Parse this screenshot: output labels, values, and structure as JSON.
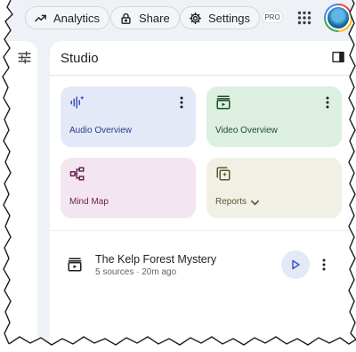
{
  "topbar": {
    "analytics_label": "Analytics",
    "share_label": "Share",
    "settings_label": "Settings",
    "pro_badge": "PRO"
  },
  "studio": {
    "title": "Studio",
    "cards": {
      "audio_overview": "Audio Overview",
      "video_overview": "Video Overview",
      "mind_map": "Mind Map",
      "reports": "Reports"
    },
    "notes": [
      {
        "title": "The Kelp Forest Mystery",
        "meta": "5 sources · 20m ago"
      }
    ]
  },
  "colors": {
    "audio_card": "#e4e9f7",
    "video_card": "#dcefe0",
    "mind_card": "#f3e6f0",
    "reports_card": "#f1f0e4",
    "accent_blue": "#3c4fc4"
  },
  "icons": {
    "analytics": "trending-up-icon",
    "share": "lock-icon",
    "settings": "gear-icon",
    "apps": "apps-grid-icon",
    "tune": "tune-icon",
    "collapse": "panel-right-icon",
    "audio": "sound-wave-sparkle-icon",
    "video": "video-icon",
    "mind_map": "mind-map-icon",
    "reports": "reports-icon",
    "more": "more-vertical-icon",
    "play": "play-icon"
  }
}
